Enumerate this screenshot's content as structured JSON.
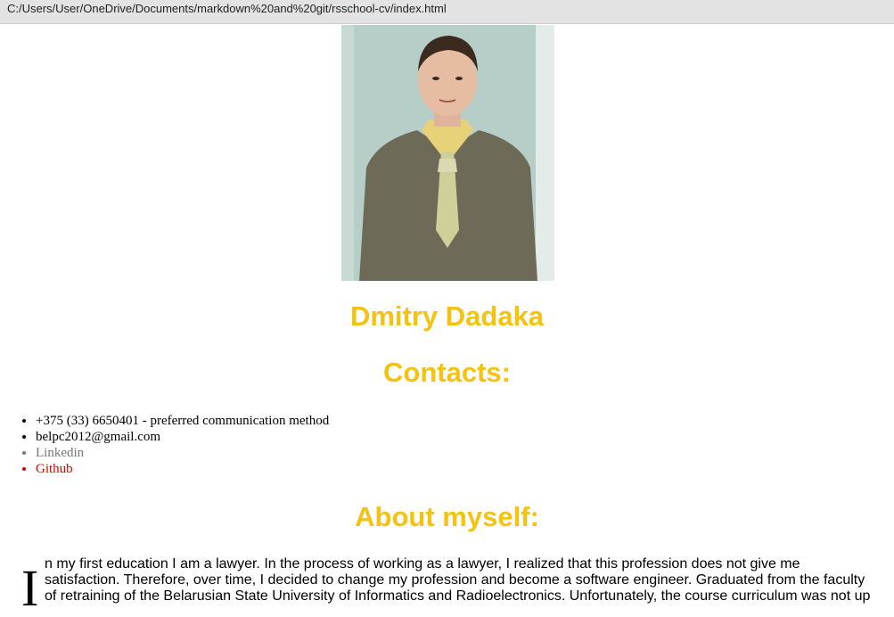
{
  "browser": {
    "url": "C:/Users/User/OneDrive/Documents/markdown%20and%20git/rsschool-cv/index.html"
  },
  "profile": {
    "name": "Dmitry Dadaka",
    "photo_alt": "portrait photo"
  },
  "contacts": {
    "heading": "Contacts:",
    "items": [
      "+375 (33) 6650401 - preferred communication method",
      "belpc2012@gmail.com",
      "Linkedin",
      "Github"
    ]
  },
  "about": {
    "heading": "About myself:",
    "drop_cap": "I",
    "text": "n my first education I am a lawyer. In the process of working as a lawyer, I realized that this profession does not give me satisfaction. Therefore, over time, I decided to change my profession and become a software engineer. Graduated from the faculty of retraining of the Belarusian State University of Informatics and Radioelectronics. Unfortunately, the course curriculum was not up"
  },
  "colors": {
    "heading": "#f5c211",
    "link_linkedin": "#777777",
    "link_github": "#e00000"
  }
}
